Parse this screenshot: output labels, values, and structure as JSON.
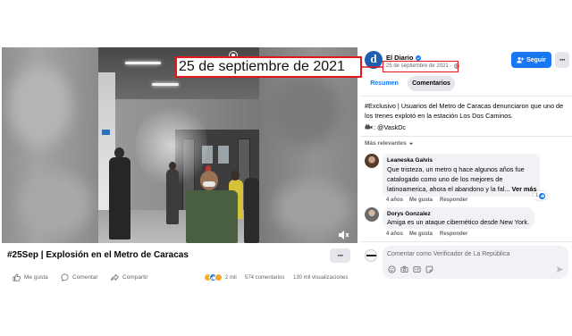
{
  "annotation": {
    "date_label": "25 de septiembre de 2021"
  },
  "video": {
    "watermark_icon": "metro-logo-icon",
    "mute_icon": "speaker-muted-icon"
  },
  "post": {
    "title": "#25Sep | Explosión en el Metro de Caracas",
    "more_label": "···",
    "actions": [
      {
        "label": "Me gusta",
        "icon": "like-icon"
      },
      {
        "label": "Comentar",
        "icon": "comment-icon"
      },
      {
        "label": "Compartir",
        "icon": "share-icon"
      }
    ],
    "reaction_icons": [
      "wow-reaction-icon",
      "like-reaction-icon",
      "sad-reaction-icon"
    ],
    "reactions_count": "2 mil",
    "comments_count": "574 comentarios",
    "views_count": "130 mil visualizaciones"
  },
  "page": {
    "name": "El Diario",
    "logo_letter": "d",
    "verified_icon": "verified-badge-icon",
    "date": "25 de septiembre de 2021",
    "audience_icon": "globe-icon",
    "follow_label": "Seguir",
    "follow_icon": "follow-icon",
    "more_label": "···"
  },
  "tabs": [
    {
      "label": "Resumen",
      "active": true
    },
    {
      "label": "Comentarios",
      "active": false
    }
  ],
  "description": {
    "lines": [
      "#Exclusivo | Usuarios del Metro de Caracas denunciaron que uno de",
      "los trenes explotó en la estación Los Dos Caminos."
    ],
    "credit_icon": "video-camera-icon",
    "credit": ": @VaskDc"
  },
  "sort": {
    "label": "Más relevantes",
    "icon": "caret-down-icon"
  },
  "comments": [
    {
      "author": "Leaneska Galvis",
      "lines": [
        "Que tristeza, un metro q hace algunos años fue",
        "catalogado como uno de los mejores de",
        "latinoamerica, ahora el abandono y la fal..."
      ],
      "see_more": "Ver más",
      "reaction_count": "1",
      "time": "4 años",
      "like": "Me gusta",
      "reply": "Responder"
    },
    {
      "author": "Dorys Gonzalez",
      "text": "Amiga es un ataque cibernético desde New York.",
      "time": "4 años",
      "like": "Me gusta",
      "reply": "Responder"
    }
  ],
  "composer": {
    "placeholder": "Comentar como Verificador de La República",
    "tools": [
      "emoji-icon",
      "camera-icon",
      "gif-icon",
      "sticker-icon"
    ],
    "send_icon": "send-icon"
  },
  "colors": {
    "brand_blue": "#1877f2",
    "text_primary": "#050505",
    "text_secondary": "#65676b",
    "bubble": "#f0f2f5",
    "annotation_red": "#e3161b"
  }
}
